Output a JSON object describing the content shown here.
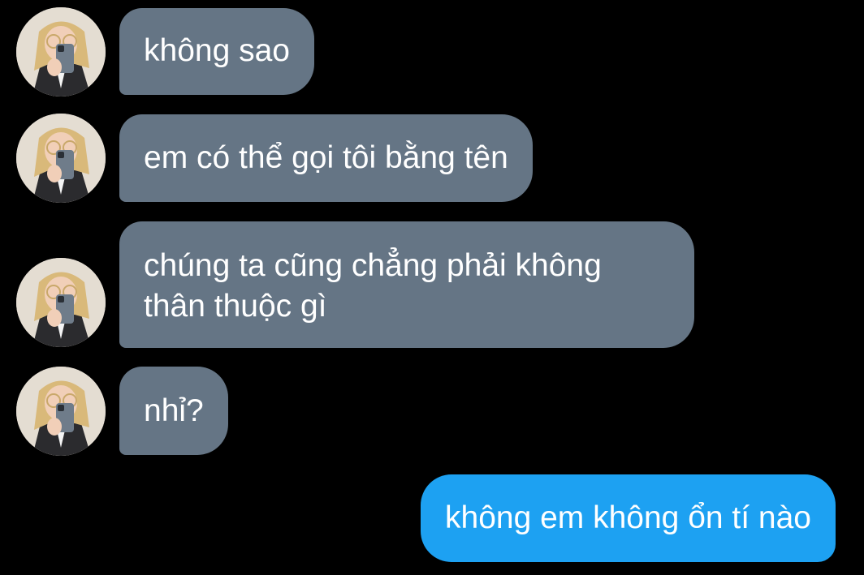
{
  "conversation": {
    "incoming_messages": [
      {
        "lines": [
          "không sao"
        ]
      },
      {
        "lines": [
          "em có thể gọi tôi bằng tên"
        ]
      },
      {
        "lines": [
          "chúng ta cũng chẳng phải không",
          "thân thuộc gì"
        ]
      },
      {
        "lines": [
          "nhỉ?"
        ]
      }
    ],
    "outgoing_messages": [
      {
        "lines": [
          "không em không ổn tí nào"
        ]
      }
    ]
  },
  "colors": {
    "background": "#000000",
    "incoming_bubble": "#657585",
    "outgoing_bubble": "#1da1f2",
    "text": "#ffffff"
  },
  "icons": {
    "avatar": "user-photo-avatar"
  }
}
